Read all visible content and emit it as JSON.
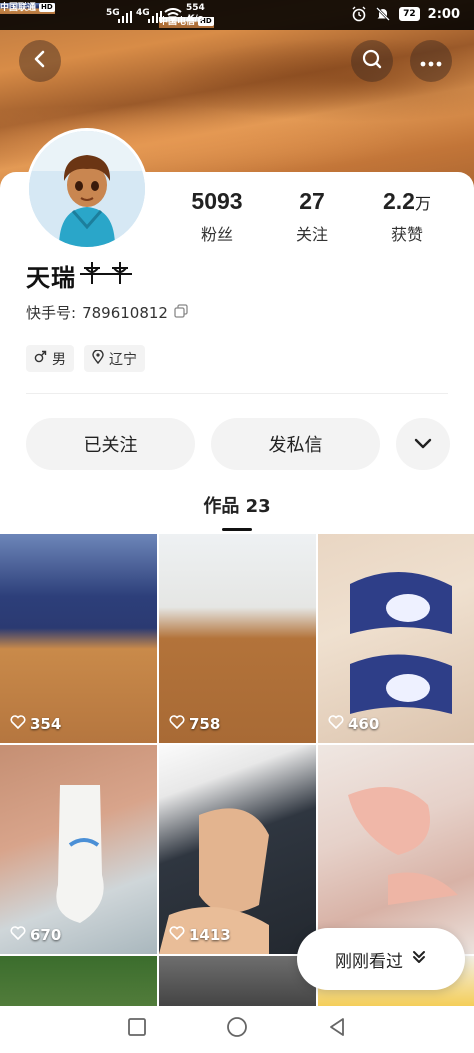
{
  "status_bar": {
    "carrier_1": "中国联通",
    "carrier_2": "中国电信",
    "hd_badge": "HD",
    "signal_1": "5G",
    "signal_2": "4G",
    "net_speed_value": "554",
    "net_speed_unit": "K/s",
    "battery": "72",
    "time": "2:00"
  },
  "profile": {
    "name": "天瑞",
    "name_decoration": "⚲⚲",
    "id_label": "快手号:",
    "id_value": "789610812",
    "stats": [
      {
        "value": "5093",
        "unit": "",
        "label": "粉丝"
      },
      {
        "value": "27",
        "unit": "",
        "label": "关注"
      },
      {
        "value": "2.2",
        "unit": "万",
        "label": "获赞"
      }
    ],
    "tags": [
      {
        "icon": "male-icon",
        "text": "男"
      },
      {
        "icon": "location-pin-icon",
        "text": "辽宁"
      }
    ]
  },
  "actions": {
    "follow_label": "已关注",
    "message_label": "发私信"
  },
  "works": {
    "tab_label": "作品 23",
    "items": [
      {
        "likes": "354"
      },
      {
        "likes": "758"
      },
      {
        "likes": "460"
      },
      {
        "likes": "670"
      },
      {
        "likes": "1413"
      },
      {
        "likes": ""
      },
      {
        "likes": ""
      },
      {
        "likes": ""
      },
      {
        "likes": ""
      }
    ]
  },
  "recent_pill": {
    "label": "刚刚看过"
  },
  "colors": {
    "accent_text": "#222222",
    "pill_bg": "#f3f3f3",
    "banner": "#c27538"
  }
}
